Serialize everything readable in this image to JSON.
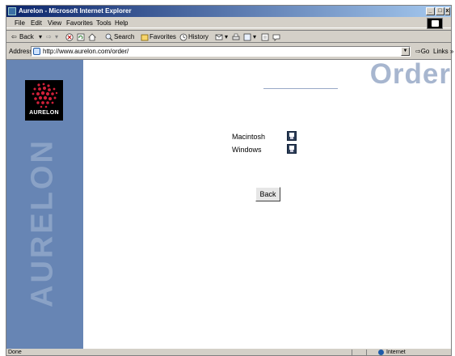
{
  "window": {
    "title": "Aurelon - Microsoft Internet Explorer",
    "minimize": "_",
    "maximize": "□",
    "close": "x"
  },
  "menu": [
    "File",
    "Edit",
    "View",
    "Favorites",
    "Tools",
    "Help"
  ],
  "toolbar": {
    "back": "Back",
    "search": "Search",
    "favorites": "Favorites",
    "history": "History"
  },
  "address": {
    "label": "Address",
    "url": "http://www.aurelon.com/order/",
    "go": "Go",
    "links": "Links »"
  },
  "page": {
    "logo_text": "AURELON",
    "sidebar_word": "AURELON",
    "heading": "Order",
    "platforms": [
      {
        "label": "Macintosh",
        "icon": "floppy-disk-icon"
      },
      {
        "label": "Windows",
        "icon": "floppy-disk-icon"
      }
    ],
    "back_button": "Back"
  },
  "status": {
    "left": "Done",
    "zone": "Internet"
  },
  "colors": {
    "sidebar": "#6785b4",
    "heading": "#a7b6cf",
    "title_gradient_start": "#0a246a"
  }
}
